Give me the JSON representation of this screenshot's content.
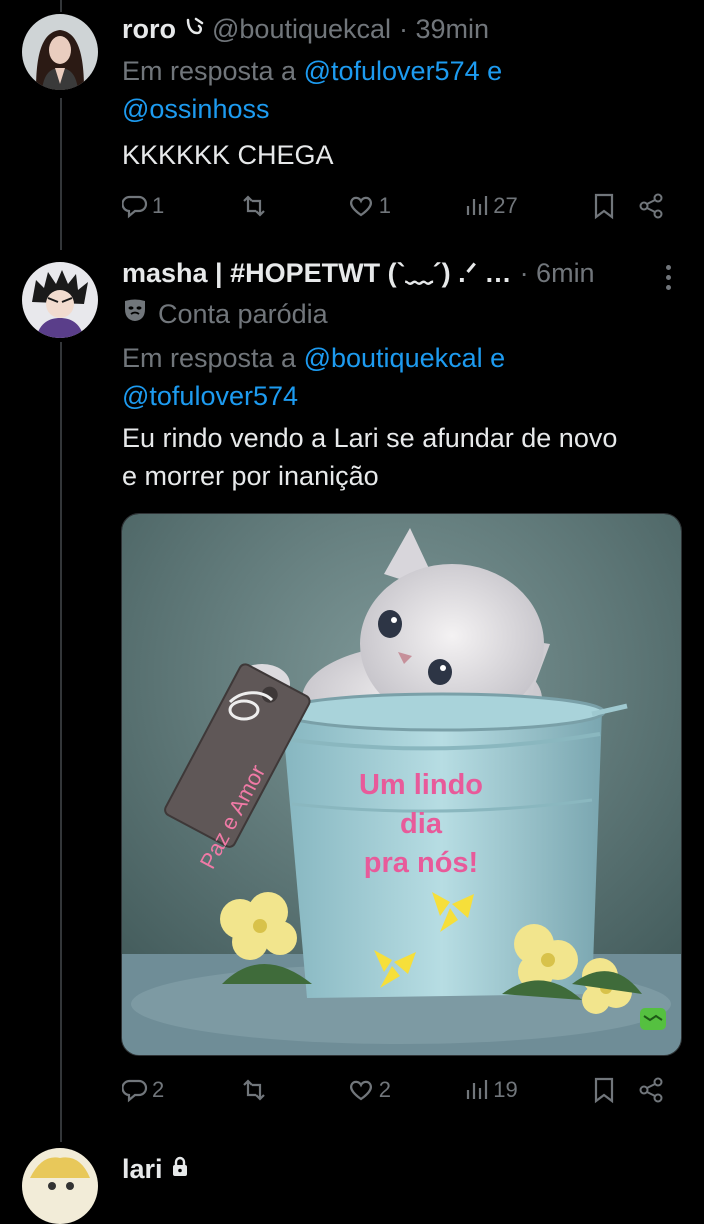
{
  "tweets": [
    {
      "name": "roro",
      "handle": "@boutiquekcal",
      "time": "· 39min",
      "reply_prefix": "Em resposta a",
      "reply_users": [
        "@tofulover574",
        "@ossinhoss"
      ],
      "reply_and": "e",
      "text": "KKKKKK CHEGA",
      "actions": {
        "replies": "1",
        "retweets": "",
        "likes": "1",
        "views": "27"
      }
    },
    {
      "name": "masha | #HOPETWT (`﹏´) .ᐟ …",
      "time": "· 6min",
      "badge": "Conta paródia",
      "reply_prefix": "Em resposta a",
      "reply_users": [
        "@boutiquekcal",
        "@tofulover574"
      ],
      "reply_and": "e",
      "text_line1": "Eu rindo vendo a Lari se afundar de novo",
      "text_line2": "e morrer por inanição",
      "image": {
        "bucket_text_1": "Um lindo",
        "bucket_text_2": "dia",
        "bucket_text_3": "pra nós!",
        "tag_text": "Paz e Amor"
      },
      "actions": {
        "replies": "2",
        "retweets": "",
        "likes": "2",
        "views": "19"
      }
    },
    {
      "name": "lari"
    }
  ]
}
